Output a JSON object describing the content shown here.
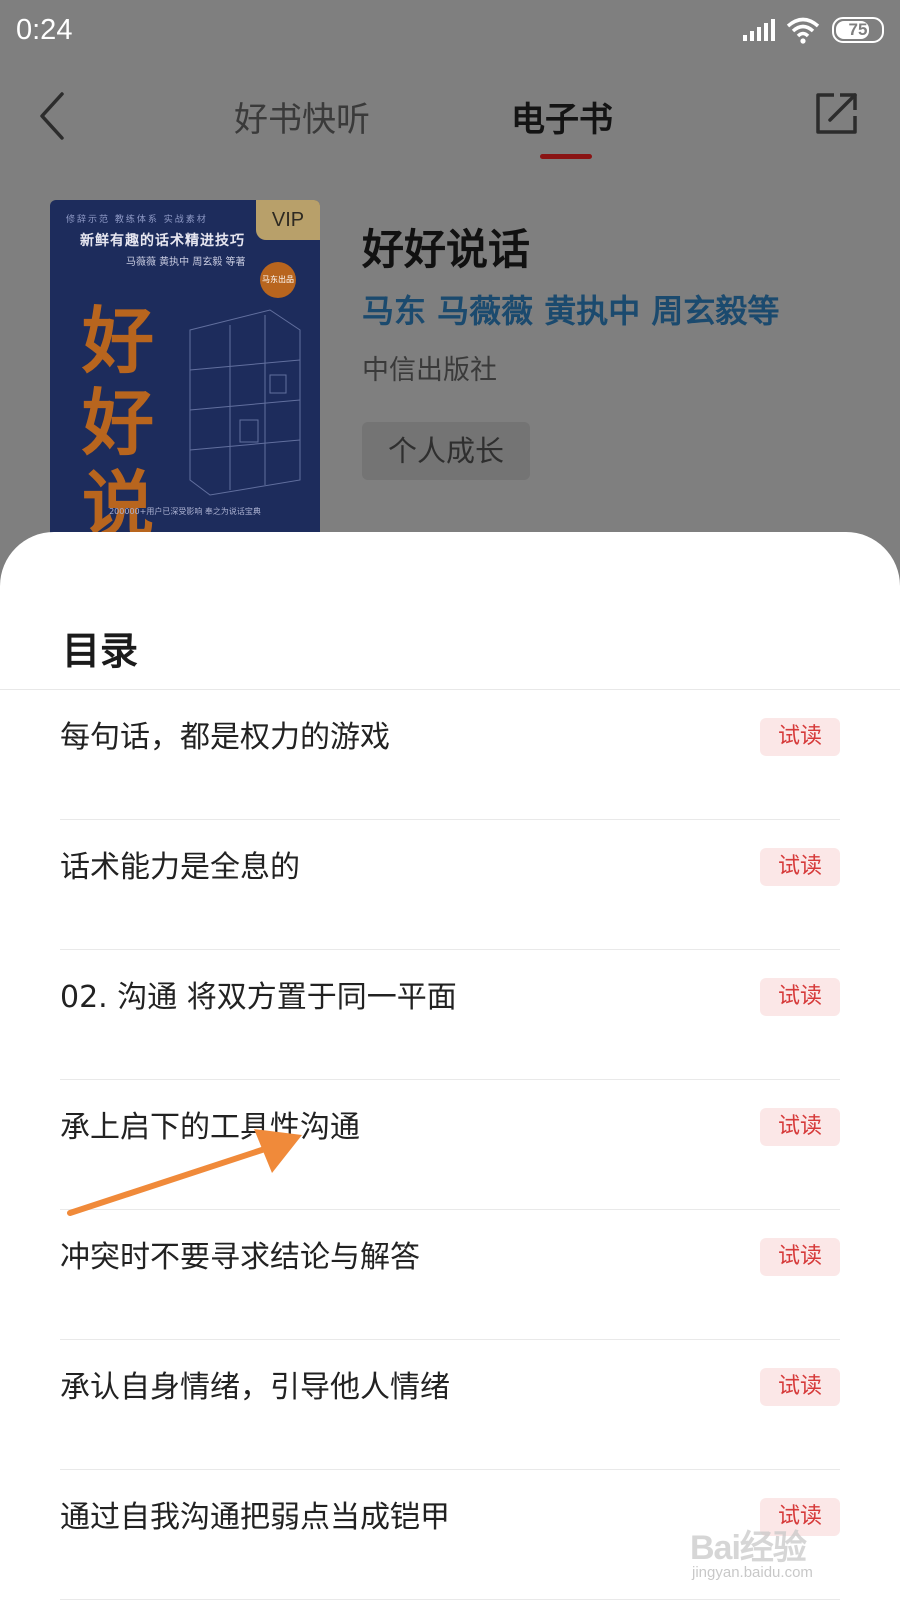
{
  "status_bar": {
    "time": "0:24",
    "battery": "75",
    "battery_level": 0.75
  },
  "nav": {
    "tabs": [
      {
        "label": "好书快听",
        "active": false
      },
      {
        "label": "电子书",
        "active": true
      }
    ]
  },
  "book": {
    "title": "好好说话",
    "authors": "马东 马薇薇 黄执中 周玄毅等",
    "publisher": "中信出版社",
    "tag": "个人成长",
    "cover": {
      "top_row": "修辞示范  教练体系  实战素材",
      "subtitle": "新鲜有趣的话术精进技巧",
      "authors": "马薇薇  黄执中  周玄毅  等著",
      "badge": "马东出品",
      "title": "好好说话",
      "vip": "VIP",
      "footer": "200000+用户已深受影响 奉之为说话宝典"
    }
  },
  "toc": {
    "title": "目录",
    "trial_label": "试读",
    "chapters": [
      "每句话，都是权力的游戏",
      "话术能力是全息的",
      "02. 沟通 将双方置于同一平面",
      "承上启下的工具性沟通",
      "冲突时不要寻求结论与解答",
      "承认自身情绪，引导他人情绪",
      "通过自我沟通把弱点当成铠甲"
    ]
  },
  "colors": {
    "accent": "#d63a3a",
    "tab_indicator": "#c0262a",
    "author_link": "#2b8fd1",
    "cover_blue": "#1d2c5c",
    "cover_orange": "#e07a1f",
    "annotation_arrow": "#f08a3a"
  },
  "watermark": {
    "logo": "Bai经验",
    "url": "jingyan.baidu.com"
  }
}
